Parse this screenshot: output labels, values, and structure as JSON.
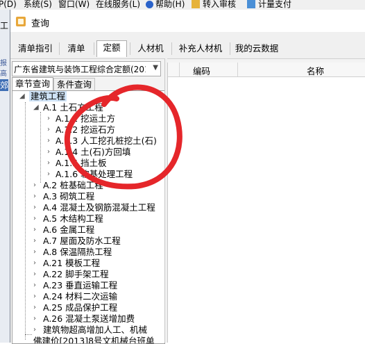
{
  "app_menu": {
    "items": [
      "P(D)",
      "系统(S)",
      "窗口(W)",
      "在线服务(L)",
      "帮助(H)",
      "转入审核",
      "计量支付"
    ]
  },
  "background": {
    "left_fragments": [
      "工",
      "报高",
      "郊"
    ]
  },
  "dialog": {
    "title": "查询",
    "tabs": [
      "清单指引",
      "清单",
      "定额",
      "人材机",
      "补充人材机",
      "我的云数据"
    ],
    "active_tab": "定额"
  },
  "left_panel": {
    "quota_library": "广东省建筑与装饰工程综合定额(201",
    "subtabs": [
      "章节查询",
      "条件查询"
    ],
    "active_subtab": "章节查询",
    "tree": {
      "root": "建筑工程",
      "expanded_chapter": "A.1 土石方工程",
      "sections": [
        "A.1.1 挖运土方",
        "A.1.2 挖运石方",
        "A.1.3 人工挖孔桩挖土(石)",
        "A.1.4 土(石)方回填",
        "A.1.5 挡土板",
        "A.1.6 软基处理工程"
      ],
      "chapters": [
        "A.2 桩基础工程",
        "A.3 砌筑工程",
        "A.4 混凝土及钢筋混凝土工程",
        "A.5 木结构工程",
        "A.6 金属工程",
        "A.7 屋面及防水工程",
        "A.8 保温隔热工程",
        "A.21 模板工程",
        "A.22 脚手架工程",
        "A.23 垂直运输工程",
        "A.24 材料二次运输",
        "A.25 成品保护工程",
        "A.26 混凝土泵送增加费"
      ],
      "extra_items": [
        "建筑物超高增加人工、机械",
        "佛建价[2013]8号文机械台班单"
      ]
    }
  },
  "grid": {
    "columns": [
      "编码",
      "名称"
    ]
  },
  "colors": {
    "annotation_red": "#e5262a",
    "selection_blue": "#cfe3f7"
  }
}
